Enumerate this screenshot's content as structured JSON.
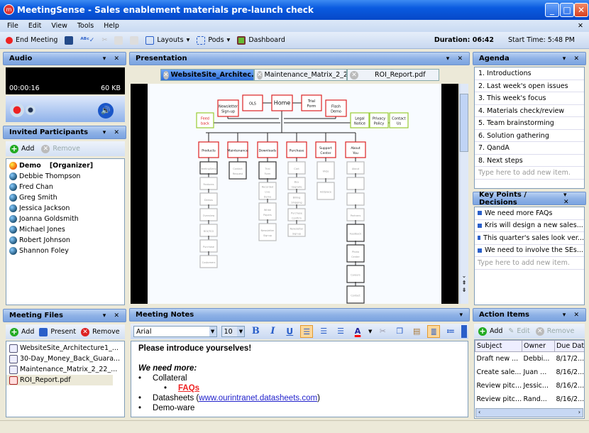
{
  "window": {
    "title": "MeetingSense - Sales enablement materials pre-launch check"
  },
  "menu": [
    "File",
    "Edit",
    "View",
    "Tools",
    "Help"
  ],
  "toolbar": {
    "end_meeting": "End Meeting",
    "layouts": "Layouts",
    "pods": "Pods",
    "dashboard": "Dashboard",
    "duration": "Duration: 06:42",
    "start_time": "Start Time: 5:48 PM"
  },
  "audio": {
    "title": "Audio",
    "elapsed": "00:00:16",
    "size": "60 KB"
  },
  "participants": {
    "title": "Invited Participants",
    "add": "Add",
    "remove": "Remove",
    "organizer": "Demo",
    "organizer_role": "[Organizer]",
    "people": [
      "Debbie Thompson",
      "Fred Chan",
      "Greg Smith",
      "Jessica Jackson",
      "Joanna Goldsmith",
      "Michael Jones",
      "Robert Johnson",
      "Shannon Foley"
    ]
  },
  "files": {
    "title": "Meeting Files",
    "add": "Add",
    "present": "Present",
    "remove": "Remove",
    "items": [
      "WebsiteSite_Architecture1_...",
      "30-Day_Money_Back_Guara...",
      "Maintenance_Matrix_2_22_...",
      "ROI_Report.pdf"
    ]
  },
  "presentation": {
    "title": "Presentation",
    "tabs": [
      "WebsiteSite_Architec...",
      "Maintenance_Matrix_2_2...",
      "ROI_Report.pdf"
    ],
    "diagram": {
      "top": [
        "Feed back",
        "Newsletter Sign-up",
        "OLS",
        "Home",
        "Trial Form",
        "Flash Demo",
        "Legal Notice",
        "Privacy Policy",
        "Contact Us"
      ],
      "sections": [
        "Products",
        "Maintenance",
        "Downloads",
        "Purchase",
        "Support Center",
        "About You"
      ],
      "children": [
        [
          "MeetingSense",
          "Features",
          "Demos",
          "Overview",
          "ROI/TCO",
          "Purchase",
          "Customers"
        ],
        [
          "Contact Request"
        ],
        [
          "Trial Form",
          "Recorded Live Demo",
          "White Papers",
          "Newsletter Signup"
        ],
        [
          "Cart",
          "Buy Upgrade",
          "Billing Shipping",
          "Purchase Confirm",
          "Newsletter Signup"
        ],
        [
          "FAQs",
          "Addplace"
        ],
        [
          "About",
          "",
          "",
          "Partners",
          "Feedback",
          "Photo Center",
          "Careers",
          "Contact"
        ]
      ]
    }
  },
  "notes": {
    "title": "Meeting Notes",
    "font": "Arial",
    "size": "10",
    "line1": "Please introduce yourselves!",
    "line2": "We need more:",
    "b1": "Collateral",
    "b1a": "FAQs",
    "b2": "Datasheets (",
    "link": "www.ourintranet.datasheets.com",
    "b2end": ")",
    "b3": "Demo-ware"
  },
  "agenda": {
    "title": "Agenda",
    "items": [
      "1.  Introductions",
      "2.  Last week's open issues",
      "3.  This week's focus",
      "4.  Materials check/review",
      "5.  Team brainstorming",
      "6.  Solution gathering",
      "7.  QandA",
      "8.  Next steps"
    ],
    "placeholder": "Type here to add new item."
  },
  "keypoints": {
    "title": "Key Points / Decisions",
    "items": [
      "We need more FAQs",
      "Kris will design a new sales...",
      "This quarter's sales look ver...",
      "We need to involve the SEs..."
    ],
    "placeholder": "Type here to add new item."
  },
  "actions": {
    "title": "Action Items",
    "add": "Add",
    "edit": "Edit",
    "remove": "Remove",
    "columns": [
      "Subject",
      "Owner",
      "Due Date"
    ],
    "rows": [
      [
        "Draft new ...",
        "Debbi...",
        "8/17/2..."
      ],
      [
        "Create sale...",
        "Juan ...",
        "8/16/2..."
      ],
      [
        "Review pitc...",
        "Jessic...",
        "8/16/2..."
      ],
      [
        "Review pitc...",
        "Rand...",
        "8/16/2..."
      ]
    ]
  }
}
